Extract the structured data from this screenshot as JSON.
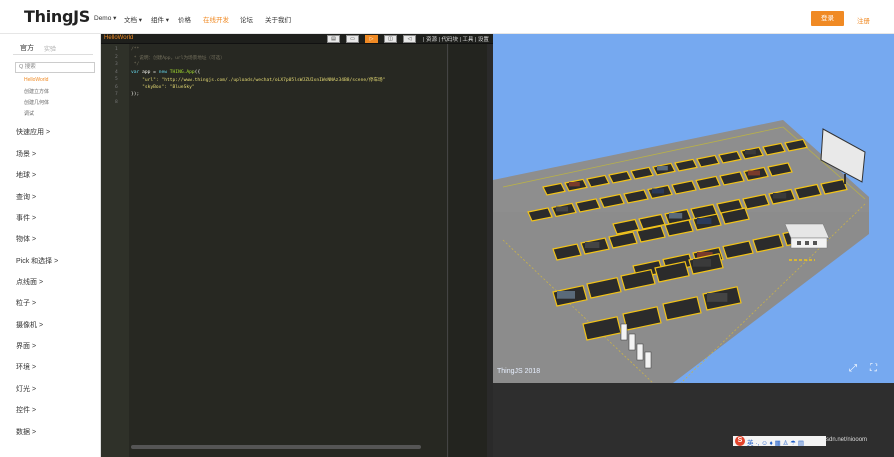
{
  "brand": {
    "logo": "ThingJS"
  },
  "nav": {
    "items": [
      {
        "label": "Demo ▾"
      },
      {
        "label": "文档 ▾"
      },
      {
        "label": "组件 ▾"
      },
      {
        "label": "价格"
      },
      {
        "label": "在线开发",
        "active": true
      },
      {
        "label": "论坛"
      },
      {
        "label": "关于我们"
      }
    ],
    "login": "登录",
    "register": "注册"
  },
  "sidebar": {
    "tabs": {
      "official": "官方",
      "lab": "实验"
    },
    "search_placeholder": "Q 搜索",
    "sub_items": [
      {
        "label": "HelloWorld",
        "active": true
      },
      {
        "label": "创建立方体"
      },
      {
        "label": "创建几何体"
      },
      {
        "label": "调试"
      }
    ],
    "categories": [
      "快速应用 >",
      "场景 >",
      "地球 >",
      "查询 >",
      "事件 >",
      "物体 >",
      "Pick 和选择 >",
      "点线面 >",
      "粒子 >",
      "摄像机 >",
      "界面 >",
      "环境 >",
      "灯光 >",
      "控件 >",
      "数据 >"
    ]
  },
  "editor": {
    "title": "HelloWorld",
    "toolbar_links": "| 资源 | 代码块 | 工具 | 设置",
    "line_numbers": [
      "1",
      "2",
      "3",
      "4",
      "5",
      "6",
      "7",
      "8"
    ],
    "code": {
      "l1": "/**",
      "l2": " * 说明：创建App，url为场景地址（可选）",
      "l3": " */",
      "l4_kw": "var",
      "l4_a": " app = ",
      "l4_new": "new",
      "l4_cls": " THING.App",
      "l4_b": "({",
      "l5_key": "    \"url\": ",
      "l5_val": "\"http://www.thingjs.com/./uploads/wechat/oLX7p05lsWJZUIxnIWsNNAz34B8/scene/停车场\"",
      "l6_key": "    \"skyBox\": ",
      "l6_val": "\"BlueSky\"",
      "l7": "});"
    }
  },
  "view3d": {
    "watermark": "ThingJS 2018",
    "icons": [
      "expand-icon",
      "fullscreen-icon"
    ],
    "colors": {
      "sky": "#76a9f0",
      "ground": "#8a8a8a",
      "lines": "#f2c318"
    }
  },
  "taskbar": {
    "ime_logo": "S",
    "ime_text": "英 ·, ☺ ♦ ▦ ♙ ☂ ▤",
    "csdn": "sdn.net/niooom"
  }
}
